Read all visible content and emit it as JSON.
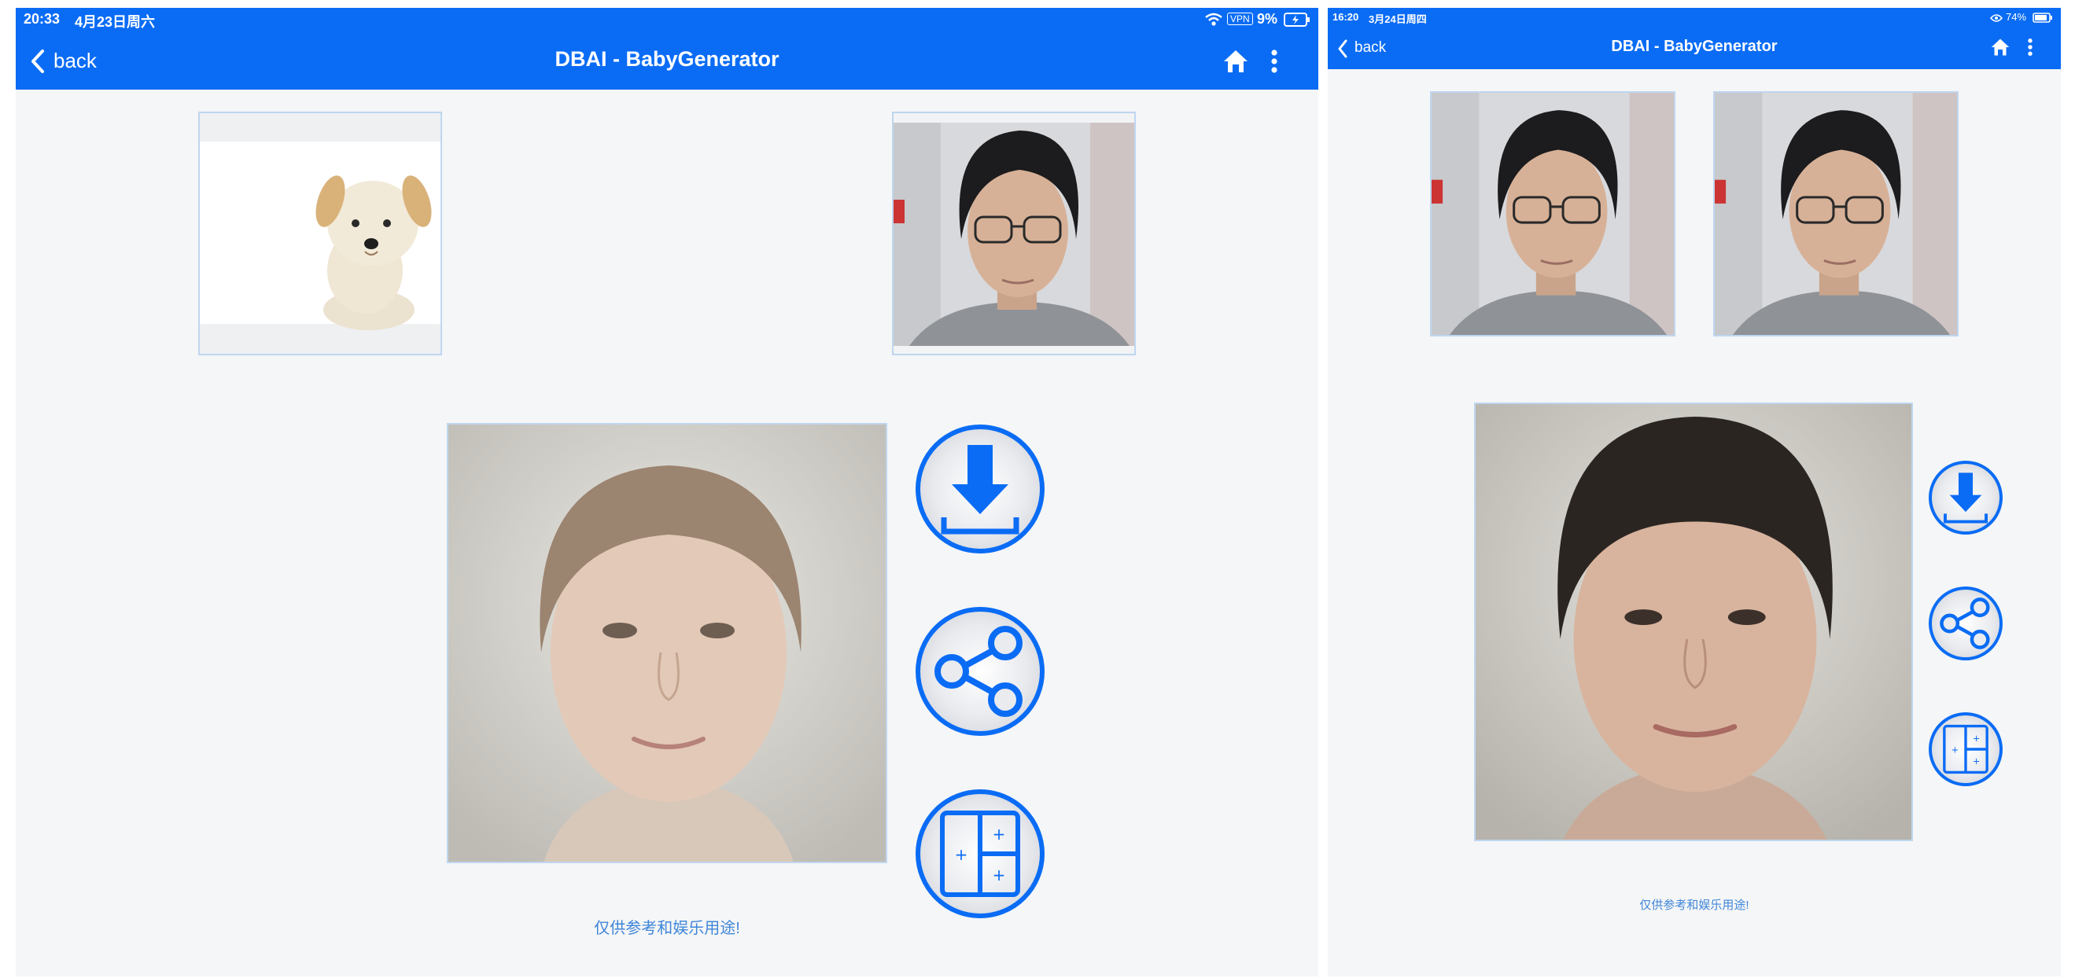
{
  "left": {
    "status": {
      "time": "20:33",
      "date": "4月23日周六",
      "vpn": "VPN",
      "battery": "9%"
    },
    "nav": {
      "back": "back",
      "title": "DBAI - BabyGenerator"
    },
    "disclaimer": "仅供参考和娱乐用途!",
    "thumb_left": "puppy photo",
    "thumb_right": "man with glasses photo",
    "result": "generated face result"
  },
  "right": {
    "status": {
      "time": "16:20",
      "date": "3月24日周四",
      "battery": "74%"
    },
    "nav": {
      "back": "back",
      "title": "DBAI - BabyGenerator"
    },
    "disclaimer": "仅供参考和娱乐用途!"
  },
  "colors": {
    "accent": "#0a6cf5",
    "background": "#f5f6f7",
    "border": "#bfd6f0"
  },
  "icons": [
    "wifi-icon",
    "vpn-icon",
    "battery-icon",
    "back-chevron-icon",
    "home-icon",
    "more-vertical-icon",
    "download-icon",
    "share-icon",
    "layout-grid-icon"
  ]
}
